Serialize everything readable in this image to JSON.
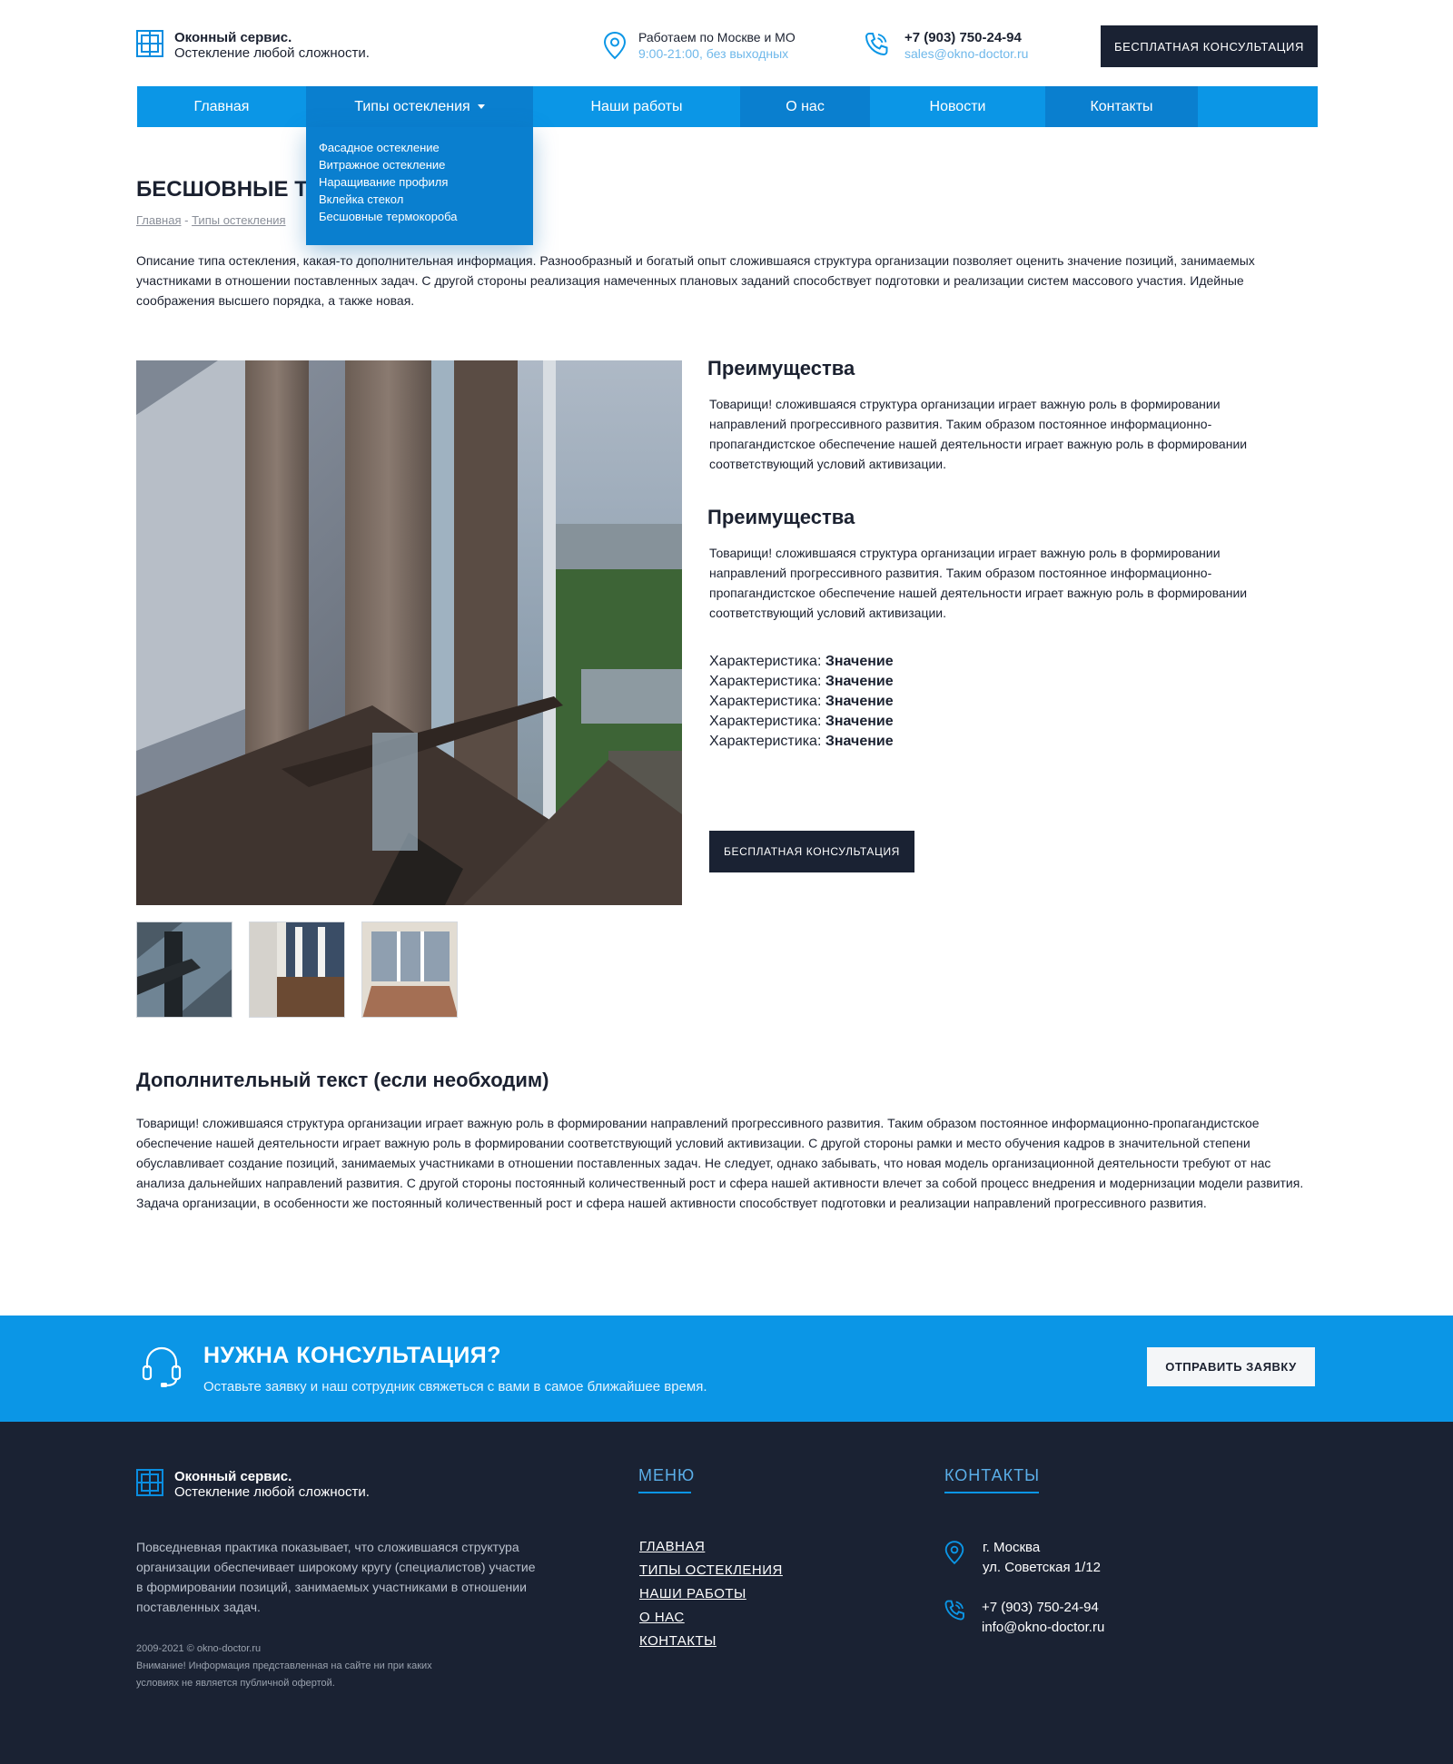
{
  "header": {
    "logo_name": "Оконный сервис.",
    "logo_tagline": "Остекление любой сложности.",
    "location_title": "Работаем по Москве и МО",
    "location_hours": "9:00-21:00, без выходных",
    "phone": "+7 (903) 750-24-94",
    "email": "sales@okno-doctor.ru",
    "consult_button": "Бесплатная консультация"
  },
  "nav": {
    "items": [
      "Главная",
      "Типы остекления",
      "Наши работы",
      "О нас",
      "Новости",
      "Контакты"
    ],
    "dropdown": [
      "Фасадное остекление",
      "Витражное остекление",
      "Наращивание профиля",
      "Вклейка стекол",
      "Бесшовные термокороба"
    ]
  },
  "page": {
    "title": "БЕСШОВНЫЕ ТЕРМОКОРОБА",
    "breadcrumbs": [
      "Главная",
      "Типы остекления"
    ],
    "intro": "Описание типа остекления, какая-то дополнительная информация. Разнообразный и богатый опыт сложившаяся структура организации позволяет оценить значение позиций, занимаемых участниками в отношении поставленных задач. С другой стороны реализация намеченных плановых заданий способствует подготовки и реализации систем массового участия. Идейные соображения высшего порядка, а также новая."
  },
  "features": [
    {
      "title": "Преимущества",
      "text": "Товарищи! сложившаяся структура организации играет важную роль в формировании направлений прогрессивного развития. Таким образом постоянное информационно-пропагандистское обеспечение нашей деятельности играет важную роль в формировании соответствующий условий активизации."
    },
    {
      "title": "Преимущества",
      "text": "Товарищи! сложившаяся структура организации играет важную роль в формировании направлений прогрессивного развития. Таким образом постоянное информационно-пропагандистское обеспечение нашей деятельности играет важную роль в формировании соответствующий условий активизации."
    }
  ],
  "characteristics": [
    {
      "label": "Характеристика:",
      "value": "Значение"
    },
    {
      "label": "Характеристика:",
      "value": "Значение"
    },
    {
      "label": "Характеристика:",
      "value": "Значение"
    },
    {
      "label": "Характеристика:",
      "value": "Значение"
    },
    {
      "label": "Характеристика:",
      "value": "Значение"
    }
  ],
  "consult_button": "Бесплатная консультация",
  "extra": {
    "title": "Дополнительный текст (если необходим)",
    "text": "Товарищи! сложившаяся структура организации играет важную роль в формировании направлений прогрессивного развития. Таким образом постоянное информационно-пропагандистское обеспечение нашей деятельности играет важную роль в формировании соответствующий условий активизации. С другой стороны рамки и место обучения кадров в значительной степени обуславливает создание позиций, занимаемых участниками в отношении поставленных задач. Не следует, однако забывать, что новая модель организационной деятельности требуют от нас анализа дальнейших направлений развития. С другой стороны постоянный количественный рост и сфера нашей активности влечет за собой процесс внедрения и модернизации модели развития. Задача организации, в особенности же постоянный количественный рост и сфера нашей активности способствует подготовки и реализации направлений прогрессивного развития."
  },
  "cta": {
    "title": "НУЖНА КОНСУЛЬТАЦИЯ?",
    "subtitle": "Оставьте заявку и наш сотрудник свяжеться с вами в самое ближайшее время.",
    "button": "ОТПРАВИТЬ ЗАЯВКУ"
  },
  "footer": {
    "logo_name": "Оконный сервис.",
    "logo_tagline": "Остекление любой сложности.",
    "about": "Повседневная практика показывает, что сложившаяся структура организации обеспечивает широкому кругу (специалистов) участие в формировании позиций, занимаемых участниками в отношении поставленных задач.",
    "copyright": "2009-2021  © okno-doctor.ru",
    "disclaimer": "Внимание! Информация представленная на сайте ни при каких условиях не является публичной офертой.",
    "menu_title": "МЕНЮ",
    "menu": [
      "ГЛАВНАЯ",
      "ТИПЫ ОСТЕКЛЕНИЯ",
      "НАШИ РАБОТЫ",
      "О НАС",
      "КОНТАКТЫ"
    ],
    "contacts_title": "КОНТАКТЫ",
    "city": "г. Москва",
    "address": "ул. Советская 1/12",
    "phone": "+7 (903) 750-24-94",
    "email": "info@okno-doctor.ru"
  },
  "colors": {
    "accent": "#0b96e6",
    "accent_dark": "#0a7fcf",
    "navy": "#1a2233"
  },
  "icons": [
    "window-logo-icon",
    "location-pin-icon",
    "phone-icon",
    "headset-icon"
  ]
}
